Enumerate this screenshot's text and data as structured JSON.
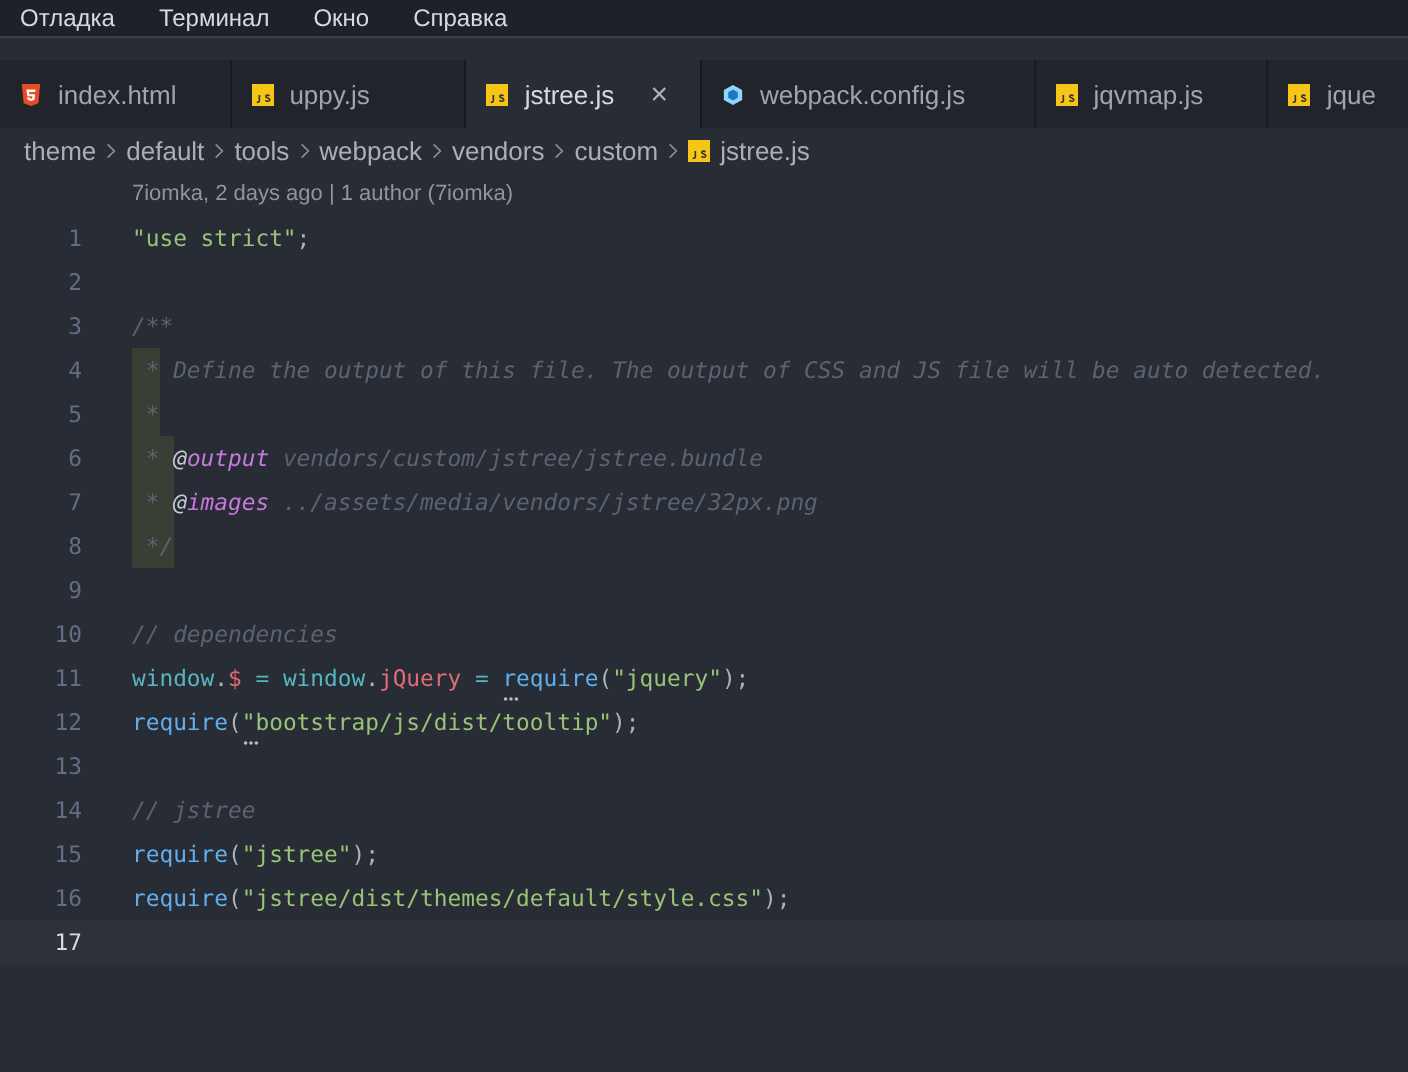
{
  "menu_bar": {
    "items": [
      "Отладка",
      "Терминал",
      "Окно",
      "Справка"
    ]
  },
  "tabs": [
    {
      "label": "index.html",
      "kind": "html",
      "selected": false
    },
    {
      "label": "uppy.js",
      "kind": "js",
      "selected": false
    },
    {
      "label": "jstree.js",
      "kind": "js",
      "selected": true,
      "close": "×"
    },
    {
      "label": "webpack.config.js",
      "kind": "webpack",
      "selected": false
    },
    {
      "label": "jqvmap.js",
      "kind": "js",
      "selected": false
    },
    {
      "label": "jque",
      "kind": "js",
      "selected": false
    }
  ],
  "breadcrumbs": [
    {
      "label": "theme",
      "kind": "folder"
    },
    {
      "label": "default",
      "kind": "folder"
    },
    {
      "label": "tools",
      "kind": "folder"
    },
    {
      "label": "webpack",
      "kind": "folder"
    },
    {
      "label": "vendors",
      "kind": "folder"
    },
    {
      "label": "custom",
      "kind": "folder"
    },
    {
      "label": "jstree.js",
      "kind": "js"
    }
  ],
  "blame": "7iomka, 2 days ago | 1 author (7iomka)",
  "lines": [
    {
      "number": "1",
      "current": false,
      "tokens": [
        {
          "kind": "string",
          "text": "\"use strict\""
        },
        {
          "kind": "punct",
          "text": ";"
        }
      ]
    },
    {
      "number": "2",
      "current": false
    },
    {
      "number": "3",
      "current": false,
      "tokens": [
        {
          "kind": "comment",
          "text": "/**"
        }
      ]
    },
    {
      "number": "4",
      "current": false,
      "tokens": [
        {
          "kind": "guide",
          "text": " *"
        },
        {
          "kind": "comment",
          "text": " Define the output of this file. The output of CSS and JS file will be auto detected."
        }
      ]
    },
    {
      "number": "5",
      "current": false,
      "tokens": [
        {
          "kind": "guide",
          "text": " *"
        }
      ]
    },
    {
      "number": "6",
      "current": false,
      "tokens": [
        {
          "kind": "guide",
          "text": " * "
        },
        {
          "kind": "at",
          "text": "@"
        },
        {
          "kind": "doctag",
          "text": "output"
        },
        {
          "kind": "comment",
          "text": " vendors/custom/jstree/jstree.bundle"
        }
      ]
    },
    {
      "number": "7",
      "current": false,
      "tokens": [
        {
          "kind": "guide",
          "text": " * "
        },
        {
          "kind": "at",
          "text": "@"
        },
        {
          "kind": "doctag",
          "text": "images"
        },
        {
          "kind": "comment",
          "text": " ../assets/media/vendors/jstree/32px.png"
        }
      ]
    },
    {
      "number": "8",
      "current": false,
      "tokens": [
        {
          "kind": "guide",
          "text": " */"
        }
      ]
    },
    {
      "number": "9",
      "current": false
    },
    {
      "number": "10",
      "current": false,
      "tokens": [
        {
          "kind": "comment",
          "text": "// dependencies"
        }
      ]
    },
    {
      "number": "11",
      "current": false,
      "tokens": [
        {
          "kind": "builtin",
          "text": "window"
        },
        {
          "kind": "punct",
          "text": "."
        },
        {
          "kind": "prop",
          "text": "$"
        },
        {
          "kind": "builtin",
          "text": " = window"
        },
        {
          "kind": "punct",
          "text": "."
        },
        {
          "kind": "prop",
          "text": "jQuery"
        },
        {
          "kind": "builtin",
          "text": " = "
        },
        {
          "kind": "func",
          "text": "require",
          "hint": true
        },
        {
          "kind": "punct",
          "text": "("
        },
        {
          "kind": "string",
          "text": "\"jquery\""
        },
        {
          "kind": "punct",
          "text": ");"
        }
      ]
    },
    {
      "number": "12",
      "current": false,
      "tokens": [
        {
          "kind": "func",
          "text": "require"
        },
        {
          "kind": "punct",
          "text": "("
        },
        {
          "kind": "string",
          "text": "\"bootstrap/js/dist/tooltip\"",
          "hint": true
        },
        {
          "kind": "punct",
          "text": ");"
        }
      ]
    },
    {
      "number": "13",
      "current": false
    },
    {
      "number": "14",
      "current": false,
      "tokens": [
        {
          "kind": "comment",
          "text": "// jstree"
        }
      ]
    },
    {
      "number": "15",
      "current": false,
      "tokens": [
        {
          "kind": "func",
          "text": "require"
        },
        {
          "kind": "punct",
          "text": "("
        },
        {
          "kind": "string",
          "text": "\"jstree\""
        },
        {
          "kind": "punct",
          "text": ");"
        }
      ]
    },
    {
      "number": "16",
      "current": false,
      "tokens": [
        {
          "kind": "func",
          "text": "require"
        },
        {
          "kind": "punct",
          "text": "("
        },
        {
          "kind": "string",
          "text": "\"jstree/dist/themes/default/style.css\""
        },
        {
          "kind": "punct",
          "text": ");"
        }
      ]
    },
    {
      "number": "17",
      "current": true
    }
  ]
}
